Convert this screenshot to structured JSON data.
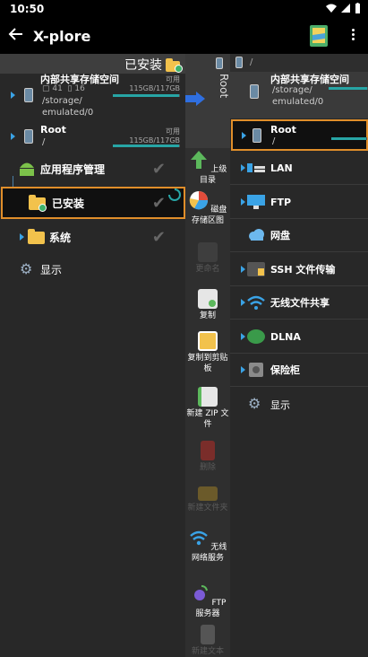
{
  "status": {
    "time": "10:50"
  },
  "appbar": {
    "title": "X-plore"
  },
  "left": {
    "header_label": "已安装",
    "drives": [
      {
        "name": "内部共享存储空间",
        "folders": "41",
        "files": "16",
        "available_label": "可用",
        "size": "115GB/117GB",
        "path": "/storage/\nemulated/0",
        "usage": 0.98
      },
      {
        "name": "Root",
        "path": "/",
        "available_label": "可用",
        "size": "115GB/117GB",
        "usage": 0.98
      }
    ],
    "rows": [
      {
        "label": "应用程序管理"
      },
      {
        "label": "已安装"
      },
      {
        "label": "系统"
      },
      {
        "label": "显示"
      }
    ]
  },
  "middle": {
    "tools": [
      {
        "label": "上级目录",
        "enabled": true
      },
      {
        "label": "磁盘存储区图",
        "enabled": true
      },
      {
        "label": "更命名",
        "enabled": false
      },
      {
        "label": "复制",
        "enabled": true
      },
      {
        "label": "复制到剪贴板",
        "enabled": true
      },
      {
        "label": "新建 ZIP 文件",
        "enabled": true
      },
      {
        "label": "删除",
        "enabled": false
      },
      {
        "label": "新建文件夹",
        "enabled": false
      },
      {
        "label": "无线网络服务",
        "enabled": true
      },
      {
        "label": "FTP 服务器",
        "enabled": true
      },
      {
        "label": "新建文本",
        "enabled": false
      }
    ],
    "vertical_tab": "Root"
  },
  "right": {
    "top_path": "/",
    "drive": {
      "name": "内部共享存储空间",
      "path": "/storage/\nemulated/0"
    },
    "root": {
      "name": "Root",
      "path": "/"
    },
    "items": [
      {
        "label": "LAN"
      },
      {
        "label": "FTP"
      },
      {
        "label": "网盘"
      },
      {
        "label": "SSH 文件传输"
      },
      {
        "label": "无线文件共享"
      },
      {
        "label": "DLNA"
      },
      {
        "label": "保险柜"
      },
      {
        "label": "显示"
      }
    ]
  },
  "colors": {
    "accent": "#3aa3e6",
    "highlight": "#e08e2a",
    "usage": "#27a5a5"
  }
}
